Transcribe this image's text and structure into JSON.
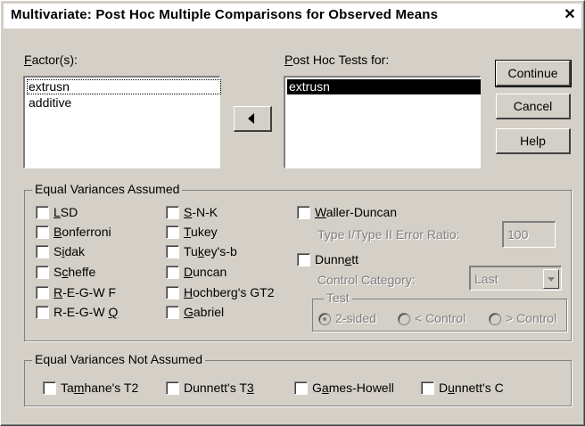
{
  "window": {
    "title": "Multivariate: Post Hoc Multiple Comparisons for Observed Means",
    "close_glyph": "✕"
  },
  "factors": {
    "label_pre": "",
    "label_key": "F",
    "label_post": "actor(s):",
    "items": [
      "extrusn",
      "additive"
    ]
  },
  "posthoc": {
    "label_pre": "",
    "label_key": "P",
    "label_post": "ost Hoc Tests for:",
    "items": [
      "extrusn"
    ]
  },
  "move_button": {
    "icon": "left-arrow-icon"
  },
  "buttons": {
    "continue": "Continue",
    "cancel": "Cancel",
    "help": "Help"
  },
  "equal_assumed": {
    "legend": "Equal Variances Assumed",
    "col1": [
      {
        "pre": "",
        "key": "L",
        "post": "SD",
        "checked": false
      },
      {
        "pre": "",
        "key": "B",
        "post": "onferroni",
        "checked": false
      },
      {
        "pre": "S",
        "key": "i",
        "post": "dak",
        "checked": false
      },
      {
        "pre": "S",
        "key": "c",
        "post": "heffe",
        "checked": false
      },
      {
        "pre": "",
        "key": "R",
        "post": "-E-G-W F",
        "checked": false
      },
      {
        "pre": "R-E-G-W ",
        "key": "Q",
        "post": "",
        "checked": false
      }
    ],
    "col2": [
      {
        "pre": "",
        "key": "S",
        "post": "-N-K",
        "checked": false
      },
      {
        "pre": "",
        "key": "T",
        "post": "ukey",
        "checked": false
      },
      {
        "pre": "Tu",
        "key": "k",
        "post": "ey's-b",
        "checked": false
      },
      {
        "pre": "",
        "key": "D",
        "post": "uncan",
        "checked": false
      },
      {
        "pre": "",
        "key": "H",
        "post": "ochberg's GT2",
        "checked": false
      },
      {
        "pre": "",
        "key": "G",
        "post": "abriel",
        "checked": false
      }
    ],
    "waller": {
      "pre": "",
      "key": "W",
      "post": "aller-Duncan",
      "checked": false
    },
    "ratio_label": "Type I/Type II Error Ratio:",
    "ratio_value": "100",
    "dunnett": {
      "pre": "Dunn",
      "key": "e",
      "post": "tt",
      "checked": false
    },
    "control_label": "Control Category:",
    "control_value": "Last",
    "test_legend": "Test",
    "radios": {
      "two_sided": "2-sided",
      "lt_control": "< Control",
      "gt_control": "> Control"
    }
  },
  "equal_not_assumed": {
    "legend": "Equal Variances Not Assumed",
    "items": [
      {
        "pre": "Ta",
        "key": "m",
        "post": "hane's T2",
        "checked": false
      },
      {
        "pre": "Dunnett's T",
        "key": "3",
        "post": "",
        "checked": false
      },
      {
        "pre": "G",
        "key": "a",
        "post": "mes-Howell",
        "checked": false
      },
      {
        "pre": "D",
        "key": "u",
        "post": "nnett's C",
        "checked": false
      }
    ]
  },
  "colors": {
    "face": "#d4d0c8",
    "selection": "#000000",
    "disabled": "#808080"
  }
}
